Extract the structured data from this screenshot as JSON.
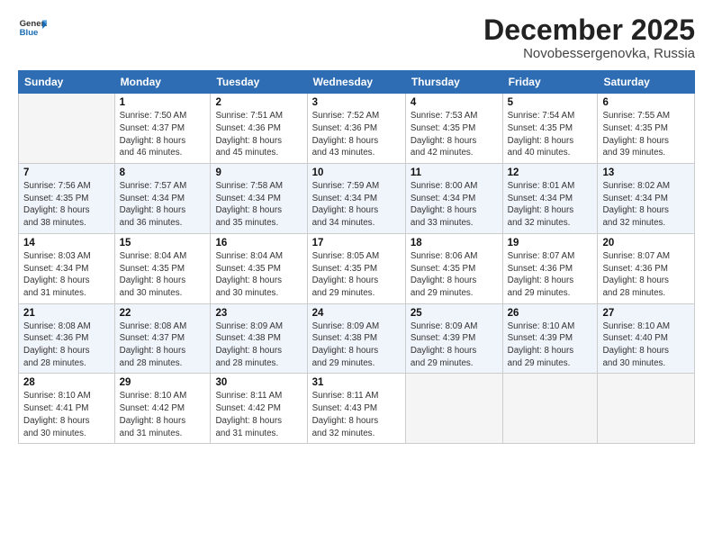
{
  "logo": {
    "line1": "General",
    "line2": "Blue"
  },
  "title": "December 2025",
  "subtitle": "Novobessergenovka, Russia",
  "days_of_week": [
    "Sunday",
    "Monday",
    "Tuesday",
    "Wednesday",
    "Thursday",
    "Friday",
    "Saturday"
  ],
  "weeks": [
    [
      {
        "day": "",
        "info": ""
      },
      {
        "day": "1",
        "info": "Sunrise: 7:50 AM\nSunset: 4:37 PM\nDaylight: 8 hours\nand 46 minutes."
      },
      {
        "day": "2",
        "info": "Sunrise: 7:51 AM\nSunset: 4:36 PM\nDaylight: 8 hours\nand 45 minutes."
      },
      {
        "day": "3",
        "info": "Sunrise: 7:52 AM\nSunset: 4:36 PM\nDaylight: 8 hours\nand 43 minutes."
      },
      {
        "day": "4",
        "info": "Sunrise: 7:53 AM\nSunset: 4:35 PM\nDaylight: 8 hours\nand 42 minutes."
      },
      {
        "day": "5",
        "info": "Sunrise: 7:54 AM\nSunset: 4:35 PM\nDaylight: 8 hours\nand 40 minutes."
      },
      {
        "day": "6",
        "info": "Sunrise: 7:55 AM\nSunset: 4:35 PM\nDaylight: 8 hours\nand 39 minutes."
      }
    ],
    [
      {
        "day": "7",
        "info": "Sunrise: 7:56 AM\nSunset: 4:35 PM\nDaylight: 8 hours\nand 38 minutes."
      },
      {
        "day": "8",
        "info": "Sunrise: 7:57 AM\nSunset: 4:34 PM\nDaylight: 8 hours\nand 36 minutes."
      },
      {
        "day": "9",
        "info": "Sunrise: 7:58 AM\nSunset: 4:34 PM\nDaylight: 8 hours\nand 35 minutes."
      },
      {
        "day": "10",
        "info": "Sunrise: 7:59 AM\nSunset: 4:34 PM\nDaylight: 8 hours\nand 34 minutes."
      },
      {
        "day": "11",
        "info": "Sunrise: 8:00 AM\nSunset: 4:34 PM\nDaylight: 8 hours\nand 33 minutes."
      },
      {
        "day": "12",
        "info": "Sunrise: 8:01 AM\nSunset: 4:34 PM\nDaylight: 8 hours\nand 32 minutes."
      },
      {
        "day": "13",
        "info": "Sunrise: 8:02 AM\nSunset: 4:34 PM\nDaylight: 8 hours\nand 32 minutes."
      }
    ],
    [
      {
        "day": "14",
        "info": "Sunrise: 8:03 AM\nSunset: 4:34 PM\nDaylight: 8 hours\nand 31 minutes."
      },
      {
        "day": "15",
        "info": "Sunrise: 8:04 AM\nSunset: 4:35 PM\nDaylight: 8 hours\nand 30 minutes."
      },
      {
        "day": "16",
        "info": "Sunrise: 8:04 AM\nSunset: 4:35 PM\nDaylight: 8 hours\nand 30 minutes."
      },
      {
        "day": "17",
        "info": "Sunrise: 8:05 AM\nSunset: 4:35 PM\nDaylight: 8 hours\nand 29 minutes."
      },
      {
        "day": "18",
        "info": "Sunrise: 8:06 AM\nSunset: 4:35 PM\nDaylight: 8 hours\nand 29 minutes."
      },
      {
        "day": "19",
        "info": "Sunrise: 8:07 AM\nSunset: 4:36 PM\nDaylight: 8 hours\nand 29 minutes."
      },
      {
        "day": "20",
        "info": "Sunrise: 8:07 AM\nSunset: 4:36 PM\nDaylight: 8 hours\nand 28 minutes."
      }
    ],
    [
      {
        "day": "21",
        "info": "Sunrise: 8:08 AM\nSunset: 4:36 PM\nDaylight: 8 hours\nand 28 minutes."
      },
      {
        "day": "22",
        "info": "Sunrise: 8:08 AM\nSunset: 4:37 PM\nDaylight: 8 hours\nand 28 minutes."
      },
      {
        "day": "23",
        "info": "Sunrise: 8:09 AM\nSunset: 4:38 PM\nDaylight: 8 hours\nand 28 minutes."
      },
      {
        "day": "24",
        "info": "Sunrise: 8:09 AM\nSunset: 4:38 PM\nDaylight: 8 hours\nand 29 minutes."
      },
      {
        "day": "25",
        "info": "Sunrise: 8:09 AM\nSunset: 4:39 PM\nDaylight: 8 hours\nand 29 minutes."
      },
      {
        "day": "26",
        "info": "Sunrise: 8:10 AM\nSunset: 4:39 PM\nDaylight: 8 hours\nand 29 minutes."
      },
      {
        "day": "27",
        "info": "Sunrise: 8:10 AM\nSunset: 4:40 PM\nDaylight: 8 hours\nand 30 minutes."
      }
    ],
    [
      {
        "day": "28",
        "info": "Sunrise: 8:10 AM\nSunset: 4:41 PM\nDaylight: 8 hours\nand 30 minutes."
      },
      {
        "day": "29",
        "info": "Sunrise: 8:10 AM\nSunset: 4:42 PM\nDaylight: 8 hours\nand 31 minutes."
      },
      {
        "day": "30",
        "info": "Sunrise: 8:11 AM\nSunset: 4:42 PM\nDaylight: 8 hours\nand 31 minutes."
      },
      {
        "day": "31",
        "info": "Sunrise: 8:11 AM\nSunset: 4:43 PM\nDaylight: 8 hours\nand 32 minutes."
      },
      {
        "day": "",
        "info": ""
      },
      {
        "day": "",
        "info": ""
      },
      {
        "day": "",
        "info": ""
      }
    ]
  ]
}
